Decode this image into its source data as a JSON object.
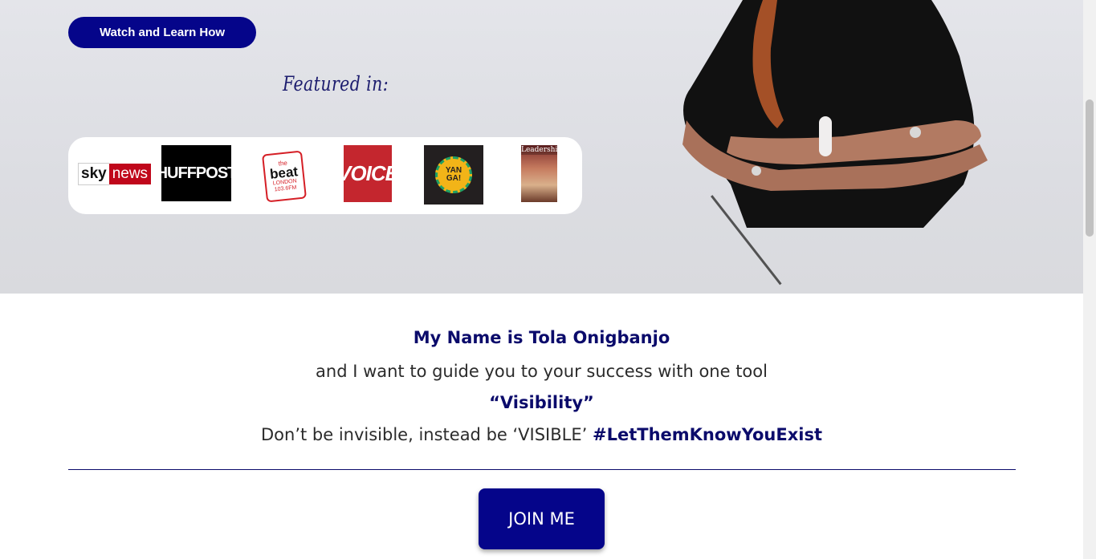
{
  "hero": {
    "watch_button": "Watch and Learn How",
    "featured_title": "Featured in:",
    "logos": {
      "sky": {
        "part1": "sky",
        "part2": "news"
      },
      "huffpost": "HUFFPOST",
      "beat": {
        "the": "the",
        "main": "beat",
        "city": "LONDON",
        "freq": "103.6FM"
      },
      "voice": "VOICE",
      "yanga": "YAN GA!",
      "leadership": "Leadership"
    }
  },
  "intro": {
    "name_line": "My Name is Tola Onigbanjo",
    "guide_line": "and I want to guide you to your success with one tool",
    "tool_line": "“Visibility”",
    "closing_text": "Don’t be invisible, instead be ‘VISIBLE’ ",
    "hashtag": "#LetThemKnowYouExist",
    "join_button": "JOIN ME"
  },
  "colors": {
    "brand_navy": "#05058a",
    "heading_navy": "#0b0b6b",
    "hero_bg": "#e0e1e6"
  }
}
